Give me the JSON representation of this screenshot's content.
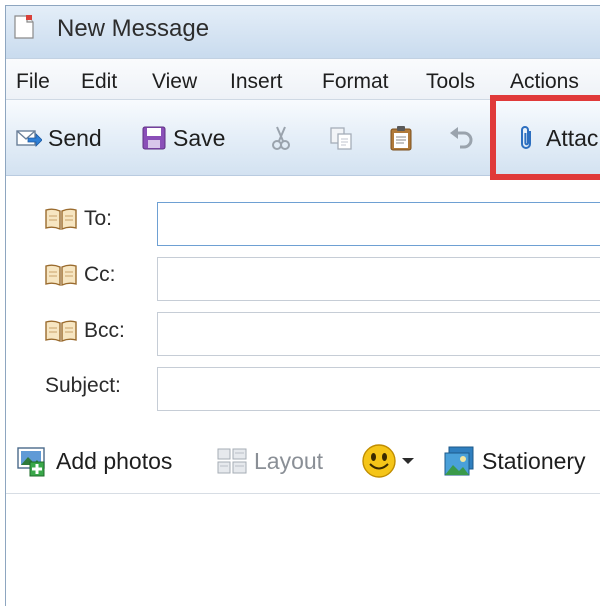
{
  "window": {
    "title": "New Message"
  },
  "menu": [
    "File",
    "Edit",
    "View",
    "Insert",
    "Format",
    "Tools",
    "Actions"
  ],
  "toolbar": {
    "send_label": "Send",
    "save_label": "Save",
    "attach_label": "Attac",
    "icons": [
      "send-icon",
      "save-icon",
      "cut-icon",
      "copy-icon",
      "paste-icon",
      "undo-icon",
      "paperclip-icon"
    ],
    "highlight_color": "#e03a3a"
  },
  "fields": {
    "to_label": "To:",
    "to_value": "",
    "cc_label": "Cc:",
    "cc_value": "",
    "bcc_label": "Bcc:",
    "bcc_value": "",
    "subject_label": "Subject:",
    "subject_value": ""
  },
  "format_bar": {
    "add_photos_label": "Add photos",
    "layout_label": "Layout",
    "stationery_label": "Stationery"
  },
  "colors": {
    "accent": "#6ea0d3",
    "titlebar": "#c9dbee",
    "highlight": "#e03a3a"
  }
}
